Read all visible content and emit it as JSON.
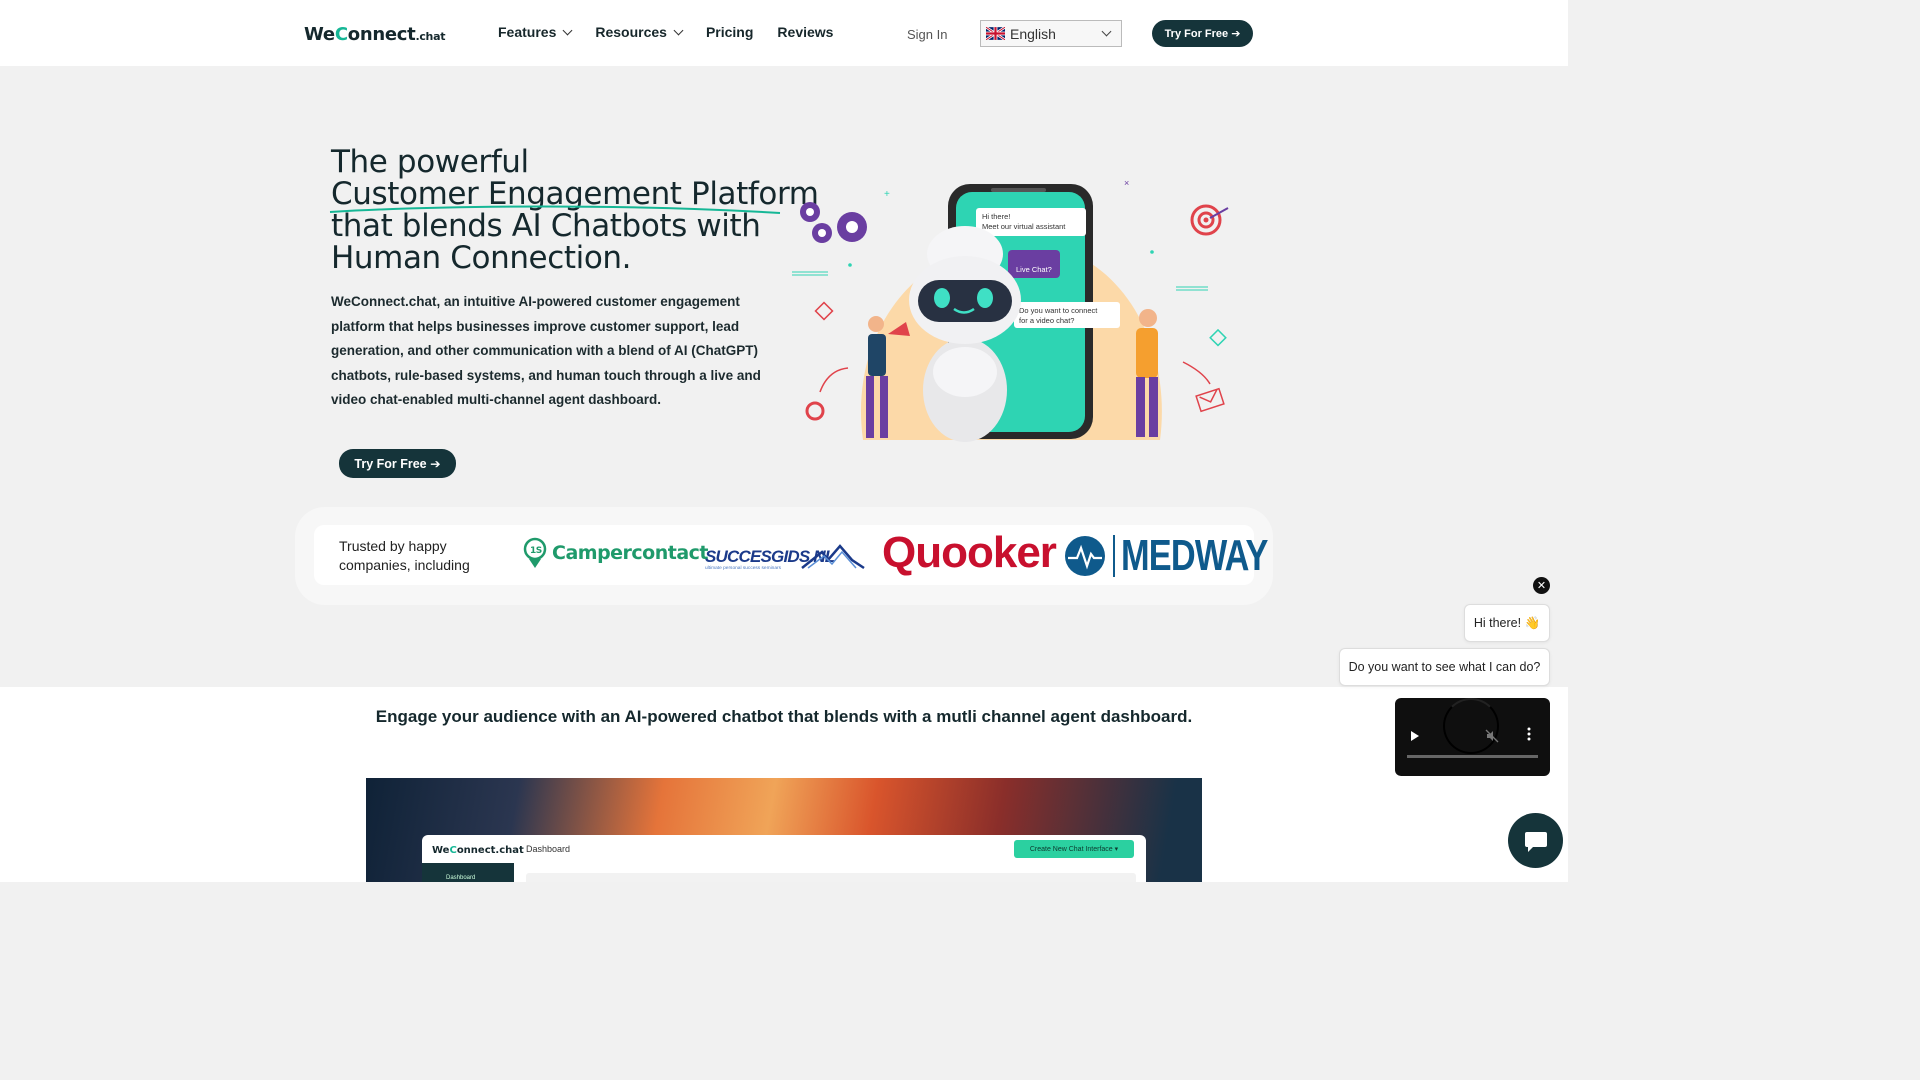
{
  "header": {
    "logo_prefix": "We",
    "logo_c": "C",
    "logo_main": "onnect",
    "logo_suffix": ".chat",
    "nav": [
      {
        "label": "Features",
        "dropdown": true
      },
      {
        "label": "Resources",
        "dropdown": true
      },
      {
        "label": "Pricing",
        "dropdown": false
      },
      {
        "label": "Reviews",
        "dropdown": false
      }
    ],
    "sign_in": "Sign In",
    "language": "English",
    "cta": "Try For Free ➔"
  },
  "hero": {
    "title_lines": [
      "The powerful",
      "Customer Engagement Platform",
      "that blends AI Chatbots with",
      "Human Connection."
    ],
    "description": "WeConnect.chat, an intuitive AI-powered customer engagement platform that helps businesses improve customer support, lead generation, and other communication with a blend of AI (ChatGPT) chatbots, rule-based systems, and human touch through a live and video chat-enabled multi-channel agent dashboard.",
    "cta": "Try For Free ➔",
    "illustration": {
      "bubble_hi": "Hi there!",
      "bubble_meet": "Meet our virtual assistant",
      "bubble_live": "Live Chat?",
      "bubble_video_1": "Do you want to connect",
      "bubble_video_2": "for a video chat?"
    }
  },
  "trusted": {
    "label": "Trusted by happy companies, including",
    "logos": {
      "campercontact": "Campercontact",
      "succesgids": "SUCCESGIDS.NL",
      "succesgids_tagline": "ultimate personal success seminars",
      "quooker": "Quooker",
      "medway": "MEDWAY"
    }
  },
  "section": {
    "title": "Engage your audience with an AI-powered chatbot that blends with a mutli channel agent dashboard.",
    "dashboard": {
      "logo": "WeConnect.chat",
      "nav_label": "Dashboard",
      "sidebar_item": "Dashboard",
      "button": "Create New Chat Interface"
    }
  },
  "chat_widget": {
    "close": "✕",
    "message_1": "Hi there! 👋",
    "message_2": "Do you want to see what I can do?"
  },
  "colors": {
    "dark_teal": "#15343a",
    "accent_green": "#16b796",
    "quooker_red": "#c8102e",
    "medway_blue": "#0f5a8c",
    "robot_phone": "#2ed4b3"
  }
}
